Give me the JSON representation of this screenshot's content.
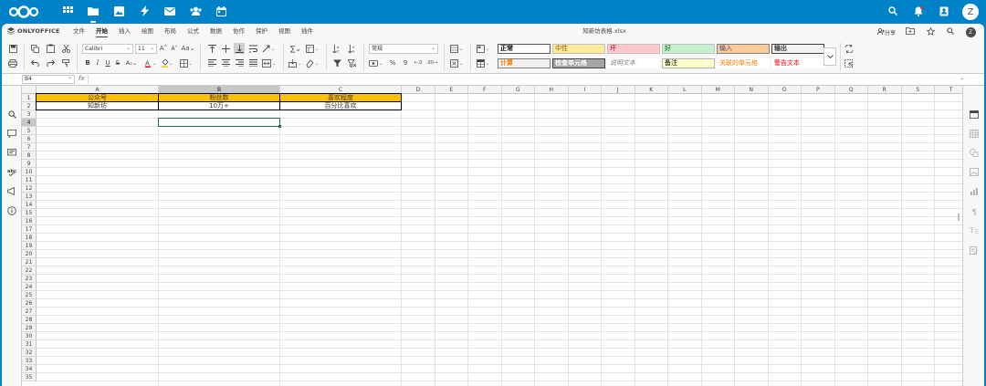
{
  "nextcloud": {
    "apps": [
      {
        "name": "dashboard",
        "icon": "dashboard-icon"
      },
      {
        "name": "files",
        "icon": "folder-icon",
        "active": true
      },
      {
        "name": "photos",
        "icon": "image-icon"
      },
      {
        "name": "activity",
        "icon": "lightning-icon"
      },
      {
        "name": "mail",
        "icon": "mail-icon"
      },
      {
        "name": "contacts",
        "icon": "contacts-icon"
      },
      {
        "name": "calendar",
        "icon": "calendar-icon"
      }
    ],
    "user_initial": "Z"
  },
  "onlyoffice": {
    "brand": "ONLYOFFICE",
    "menu_tabs": [
      "文件",
      "开始",
      "插入",
      "绘图",
      "布局",
      "公式",
      "数据",
      "协作",
      "保护",
      "视图",
      "插件"
    ],
    "active_tab": "开始",
    "doc_title": "知新坊表格.xlsx",
    "share_label": "分享",
    "user_initial": "Z"
  },
  "toolbar": {
    "font_name": "Calibri",
    "font_size": "11",
    "number_format": "常规",
    "styles": [
      {
        "label": "正常",
        "bg": "#ffffff",
        "color": "#000000",
        "border": "#555555"
      },
      {
        "label": "中性",
        "bg": "#ffeb9c",
        "color": "#9c5700",
        "border": "#c0c0c0"
      },
      {
        "label": "坏",
        "bg": "#ffc7ce",
        "color": "#9c0006",
        "border": "#c0c0c0"
      },
      {
        "label": "好",
        "bg": "#c6efce",
        "color": "#006100",
        "border": "#c0c0c0"
      },
      {
        "label": "输入",
        "bg": "#ffcc99",
        "color": "#3f3f76",
        "border": "#7f7f7f"
      },
      {
        "label": "输出",
        "bg": "#f2f2f2",
        "color": "#3f3f3f",
        "border": "#3f3f3f"
      },
      {
        "label": "计算",
        "bg": "#f2f2f2",
        "color": "#fa7d00",
        "border": "#7f7f7f"
      },
      {
        "label": "检查单元格",
        "bg": "#a5a5a5",
        "color": "#ffffff",
        "border": "#3f3f3f"
      },
      {
        "label": "说明文本",
        "bg": "#ffffff",
        "color": "#7f7f7f",
        "border": "#ffffff"
      },
      {
        "label": "备注",
        "bg": "#ffffcc",
        "color": "#000000",
        "border": "#b2b2b2"
      },
      {
        "label": "关联的单元格",
        "bg": "#ffffff",
        "color": "#fa7d00",
        "border": "#ffffff"
      },
      {
        "label": "警告文本",
        "bg": "#ffffff",
        "color": "#ff0000",
        "border": "#ffffff"
      }
    ]
  },
  "formula_bar": {
    "cell_ref": "B4",
    "fx": "fx",
    "content": ""
  },
  "sheet": {
    "columns": [
      "A",
      "B",
      "C",
      "D",
      "E",
      "F",
      "G",
      "H",
      "I",
      "J",
      "K",
      "L",
      "M",
      "N",
      "O",
      "P",
      "Q",
      "R",
      "S",
      "T"
    ],
    "rows": [
      "1",
      "2",
      "3",
      "4",
      "5",
      "6",
      "7",
      "8",
      "9",
      "10",
      "11",
      "12",
      "13",
      "14",
      "15",
      "16",
      "17",
      "18",
      "19",
      "20",
      "21",
      "22",
      "23",
      "24",
      "25",
      "26",
      "27",
      "28",
      "29",
      "30",
      "31",
      "32",
      "33",
      "34",
      "35"
    ],
    "selected_column": "B",
    "selected_row": "4",
    "header_row": [
      "公众号",
      "粉丝数",
      "喜欢程度"
    ],
    "data_row": [
      "知新坊",
      "10万+",
      "百分比喜欢"
    ],
    "header_fill": "#ffc000",
    "active_border": "#217346"
  }
}
